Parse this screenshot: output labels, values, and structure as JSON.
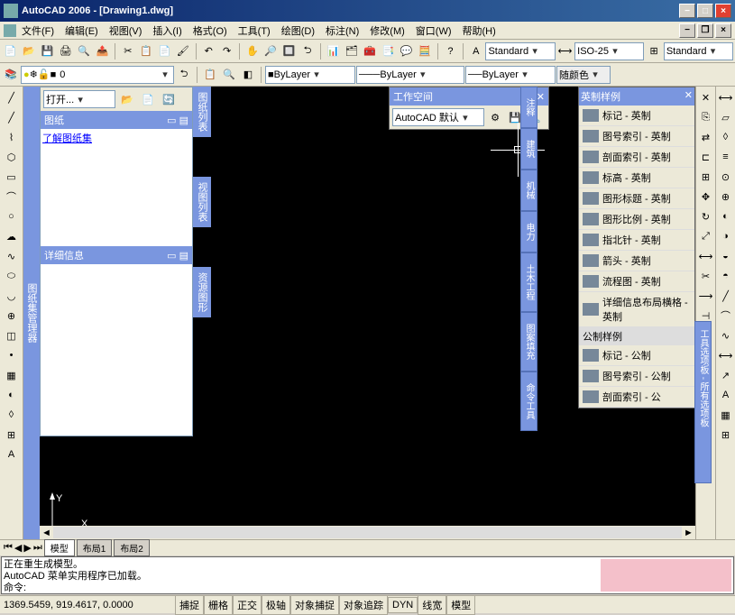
{
  "title": "AutoCAD 2006 - [Drawing1.dwg]",
  "menus": [
    "文件(F)",
    "编辑(E)",
    "视图(V)",
    "插入(I)",
    "格式(O)",
    "工具(T)",
    "绘图(D)",
    "标注(N)",
    "修改(M)",
    "窗口(W)",
    "帮助(H)"
  ],
  "style_dd1": "Standard",
  "style_dd2": "ISO-25",
  "style_dd3": "Standard",
  "layer_dd": "0",
  "bylayer1": "ByLayer",
  "bylayer2": "ByLayer",
  "bylayer3": "ByLayer",
  "color_label": "随颜色",
  "open_label": "打开...",
  "panel1_title": "图纸",
  "panel1_link": "了解图纸集",
  "panel2_title": "详细信息",
  "sidetabs_left": [
    "图纸列表",
    "视图列表",
    "资源图形"
  ],
  "sidetab_far": "图纸集管理器",
  "workspace_title": "工作空间",
  "workspace_value": "AutoCAD 默认",
  "palette_title": "英制样例",
  "palette_items": [
    "标记 - 英制",
    "图号索引 - 英制",
    "剖面索引 - 英制",
    "标高 - 英制",
    "图形标题 - 英制",
    "图形比例 - 英制",
    "指北针 - 英制",
    "箭头 - 英制",
    "流程图 - 英制",
    "详细信息布局横格 - 英制"
  ],
  "palette_section2": "公制样例",
  "palette_items2": [
    "标记 - 公制",
    "图号索引 - 公制",
    "剖面索引 - 公"
  ],
  "palette_vtabs": [
    "注释",
    "建筑",
    "机械",
    "电力",
    "土木工程",
    "图案填充",
    "命令工具"
  ],
  "palette_vtab_right": "工具选项板 - 所有选项板",
  "tabs": [
    "模型",
    "布局1",
    "布局2"
  ],
  "cmd_line1": "正在重生成模型。",
  "cmd_line2": "AutoCAD 菜单实用程序已加载。",
  "cmd_prompt": "命令:",
  "coords": "1369.5459, 919.4617, 0.0000",
  "status_btns": [
    "捕捉",
    "栅格",
    "正交",
    "极轴",
    "对象捕捉",
    "对象追踪",
    "DYN",
    "线宽",
    "模型"
  ]
}
